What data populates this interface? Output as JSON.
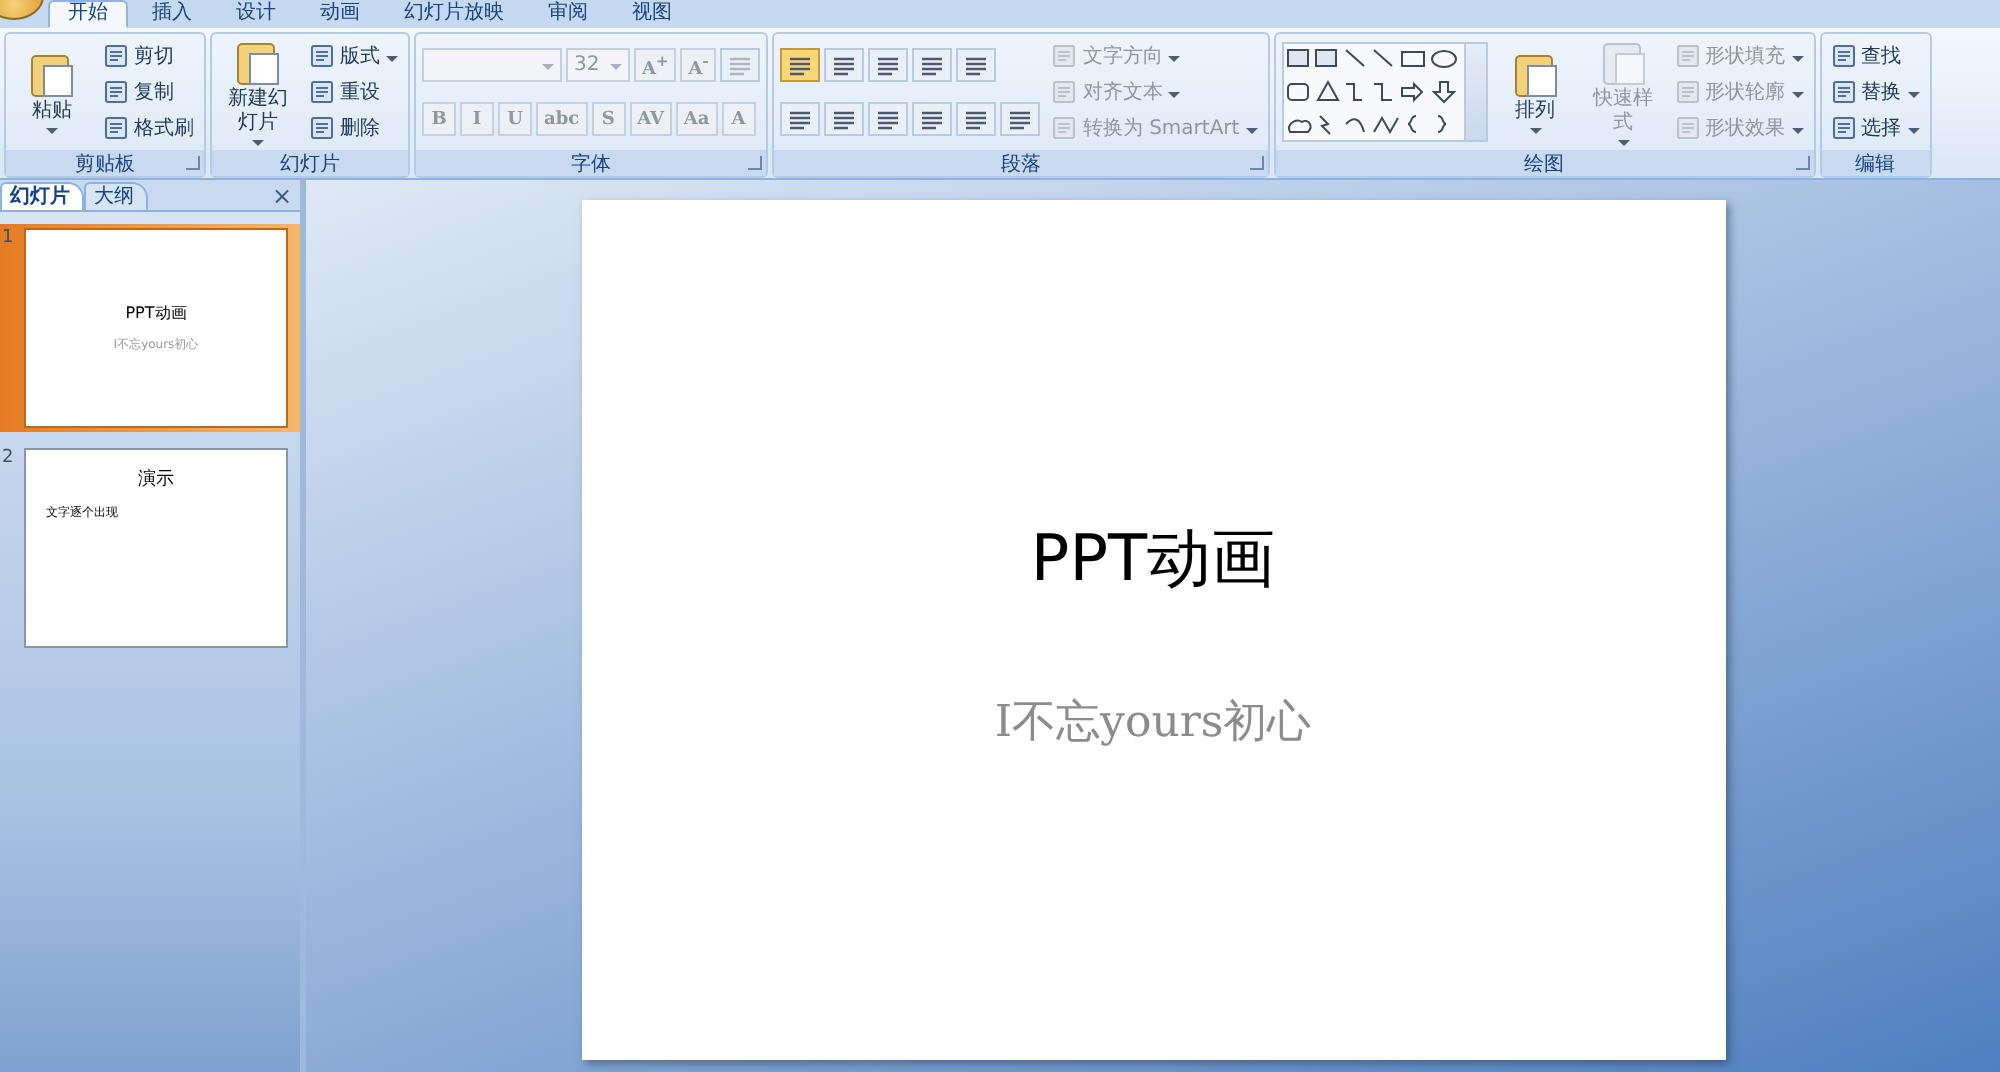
{
  "tabs": [
    {
      "label": "开始",
      "selected": true
    },
    {
      "label": "插入",
      "selected": false
    },
    {
      "label": "设计",
      "selected": false
    },
    {
      "label": "动画",
      "selected": false
    },
    {
      "label": "幻灯片放映",
      "selected": false
    },
    {
      "label": "审阅",
      "selected": false
    },
    {
      "label": "视图",
      "selected": false
    }
  ],
  "groups": [
    {
      "title": "剪贴板",
      "launcher": true,
      "columns": [
        [
          {
            "kind": "large",
            "label": "粘贴",
            "menu": true,
            "disabled": false
          }
        ],
        [
          {
            "kind": "small",
            "label": "剪切",
            "menu": false,
            "disabled": false
          },
          {
            "kind": "small",
            "label": "复制",
            "menu": false,
            "disabled": false
          },
          {
            "kind": "small",
            "label": "格式刷",
            "menu": false,
            "disabled": false
          }
        ]
      ]
    },
    {
      "title": "幻灯片",
      "launcher": false,
      "columns": [
        [
          {
            "kind": "large",
            "label": "新建幻灯片",
            "menu": true,
            "disabled": false
          }
        ],
        [
          {
            "kind": "small",
            "label": "版式",
            "menu": true,
            "disabled": false
          },
          {
            "kind": "small",
            "label": "重设",
            "menu": false,
            "disabled": false
          },
          {
            "kind": "small",
            "label": "删除",
            "menu": false,
            "disabled": false
          }
        ]
      ]
    },
    {
      "title": "字体",
      "launcher": true,
      "columns": [
        [
          {
            "kind": "row",
            "buttons": [
              {
                "kind": "combo",
                "disabled": true
              },
              {
                "kind": "combo",
                "value": "32",
                "disabled": true
              },
              {
                "kind": "glyph",
                "text": "A$^{+}$",
                "disabled": true
              },
              {
                "kind": "glyph",
                "text": "A$^{-}$",
                "disabled": true
              },
              {
                "kind": "icon",
                "selected": false,
                "disabled": true
              }
            ]
          },
          {
            "kind": "row",
            "buttons": [
              {
                "kind": "glyph",
                "text": "B",
                "disabled": true
              },
              {
                "kind": "glyph",
                "text": "I",
                "disabled": true
              },
              {
                "kind": "glyph",
                "text": "U",
                "disabled": true
              },
              {
                "kind": "glyph",
                "text": "abc",
                "disabled": true
              },
              {
                "kind": "glyph",
                "text": "S",
                "disabled": true
              },
              {
                "kind": "glyph",
                "text": "AV",
                "disabled": true
              },
              {
                "kind": "glyph",
                "text": "Aa",
                "disabled": true
              },
              {
                "kind": "glyph",
                "text": "A",
                "disabled": true
              }
            ]
          }
        ]
      ]
    },
    {
      "title": "段落",
      "launcher": true,
      "columns": [
        [
          {
            "kind": "row",
            "buttons": [
              {
                "kind": "icon",
                "selected": true,
                "disabled": false
              },
              {
                "kind": "icon",
                "selected": false,
                "disabled": false
              },
              {
                "kind": "icon",
                "selected": false,
                "disabled": false
              },
              {
                "kind": "icon",
                "selected": false,
                "disabled": false
              },
              {
                "kind": "icon",
                "selected": false,
                "disabled": false
              }
            ]
          },
          {
            "kind": "row",
            "buttons": [
              {
                "kind": "icon",
                "selected": false,
                "disabled": false
              },
              {
                "kind": "icon",
                "selected": false,
                "disabled": false
              },
              {
                "kind": "icon",
                "selected": false,
                "disabled": false
              },
              {
                "kind": "icon",
                "selected": false,
                "disabled": false
              },
              {
                "kind": "icon",
                "selected": false,
                "disabled": false
              },
              {
                "kind": "icon",
                "selected": false,
                "disabled": false
              }
            ]
          }
        ],
        [
          {
            "kind": "small",
            "label": "文字方向",
            "menu": true,
            "disabled": true
          },
          {
            "kind": "small",
            "label": "对齐文本",
            "menu": true,
            "disabled": true
          },
          {
            "kind": "small",
            "label": "转换为 SmartArt",
            "menu": true,
            "disabled": true
          }
        ]
      ]
    },
    {
      "title": "绘图",
      "launcher": true,
      "columns": [
        [
          {
            "kind": "gallery"
          }
        ],
        [
          {
            "kind": "large",
            "label": "排列",
            "menu": true,
            "disabled": false
          }
        ],
        [
          {
            "kind": "large",
            "label": "快速样式",
            "menu": true,
            "disabled": true
          }
        ],
        [
          {
            "kind": "small",
            "label": "形状填充",
            "menu": true,
            "disabled": true
          },
          {
            "kind": "small",
            "label": "形状轮廓",
            "menu": true,
            "disabled": true
          },
          {
            "kind": "small",
            "label": "形状效果",
            "menu": true,
            "disabled": true
          }
        ]
      ]
    },
    {
      "title": "编辑",
      "launcher": false,
      "columns": [
        [
          {
            "kind": "small",
            "label": "查找",
            "menu": false,
            "disabled": false
          },
          {
            "kind": "small",
            "label": "替换",
            "menu": true,
            "disabled": false
          },
          {
            "kind": "small",
            "label": "选择",
            "menu": true,
            "disabled": false
          }
        ]
      ]
    }
  ],
  "pane": {
    "tabs": [
      {
        "label": "幻灯片",
        "selected": true
      },
      {
        "label": "大纲",
        "selected": false
      }
    ],
    "close": "×",
    "slides": [
      {
        "number": "1",
        "selected": true,
        "title": "PPT动画",
        "subtitle": "I不忘yours初心"
      },
      {
        "number": "2",
        "selected": false,
        "title": "演示",
        "bullet": "文字逐个出现"
      }
    ]
  },
  "slide": {
    "title": "PPT动画",
    "subtitle": "I不忘yours初心"
  }
}
